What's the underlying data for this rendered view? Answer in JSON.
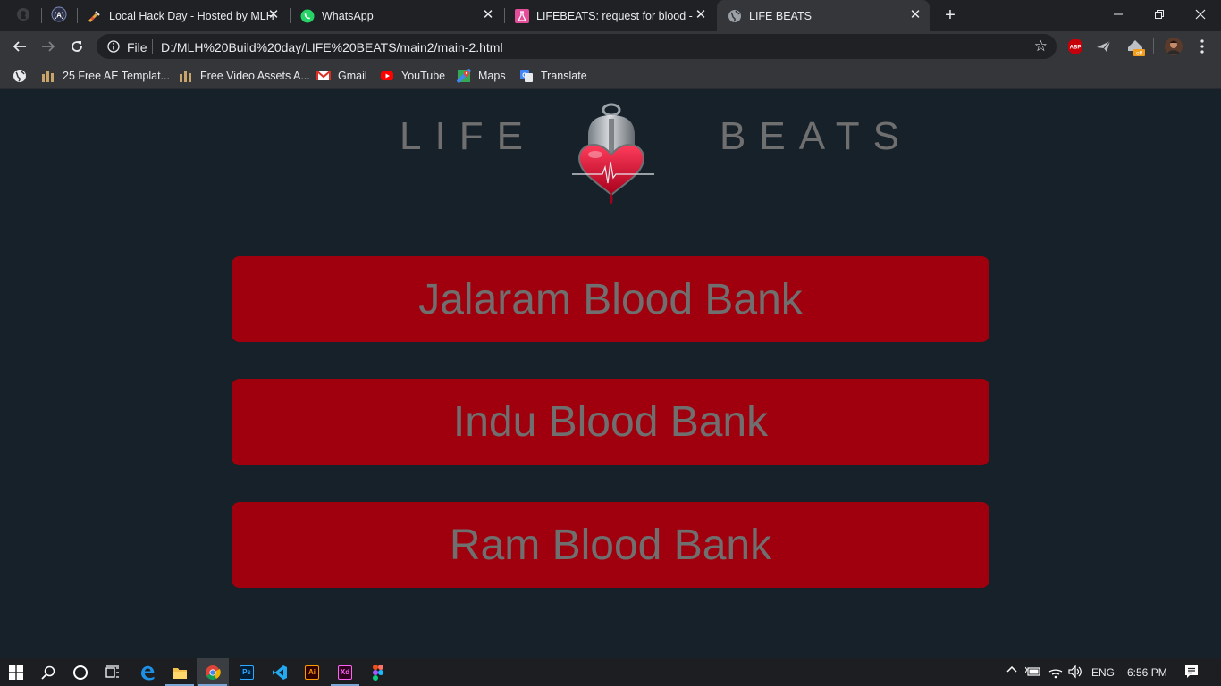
{
  "browser": {
    "tabs": [
      {
        "title": "",
        "icon": "github-icon",
        "pinned": true
      },
      {
        "title": "",
        "icon": "codeforces-icon",
        "pinned": true
      },
      {
        "title": "Local Hack Day - Hosted by MLH",
        "icon": "hackday-icon"
      },
      {
        "title": "WhatsApp",
        "icon": "whatsapp-icon"
      },
      {
        "title": "LIFEBEATS: request for blood - An",
        "icon": "flask-icon"
      },
      {
        "title": "LIFE BEATS",
        "icon": "globe-icon",
        "active": true
      }
    ],
    "new_tab_label": "+",
    "url_scheme": "File",
    "url": "D:/MLH%20Build%20day/LIFE%20BEATS/main2/main-2.html",
    "extensions": [
      "adblock-icon",
      "plane-icon",
      "offer-extension-icon",
      "profile-avatar"
    ],
    "extension_badge": "ABP",
    "offer_badge": "off",
    "bookmarks": [
      {
        "label": "",
        "icon": "globe-icon"
      },
      {
        "label": "25 Free AE Templat...",
        "icon": "bars-icon"
      },
      {
        "label": "Free Video Assets A...",
        "icon": "bars-icon"
      },
      {
        "label": "Gmail",
        "icon": "gmail-icon"
      },
      {
        "label": "YouTube",
        "icon": "youtube-icon"
      },
      {
        "label": "Maps",
        "icon": "maps-icon"
      },
      {
        "label": "Translate",
        "icon": "translate-icon"
      }
    ]
  },
  "page": {
    "brand_left": "LIFE",
    "brand_right": "BEATS",
    "banks": [
      {
        "label": "Jalaram Blood Bank"
      },
      {
        "label": "Indu Blood Bank"
      },
      {
        "label": "Ram Blood Bank"
      }
    ],
    "colors": {
      "background": "#17212a",
      "button": "#a0000d",
      "text": "#6f6f6f"
    }
  },
  "taskbar": {
    "apps": [
      "windows-start-icon",
      "search-icon",
      "cortana-icon",
      "task-view-icon",
      "edge-icon",
      "file-explorer-icon",
      "chrome-icon",
      "photoshop-icon",
      "vscode-icon",
      "illustrator-icon",
      "xd-icon",
      "figma-icon"
    ],
    "ps_label": "Ps",
    "ai_label": "Ai",
    "xd_label": "Xd",
    "language": "ENG",
    "time": "6:56 PM"
  }
}
